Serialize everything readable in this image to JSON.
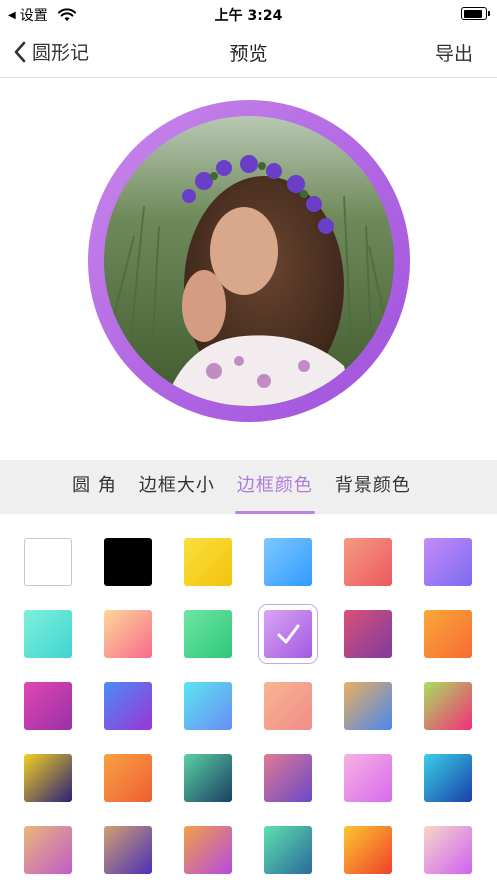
{
  "status_bar": {
    "back_app": "设置",
    "time": "上午 3:24",
    "battery_level": 0.9
  },
  "nav": {
    "back_label": "圆形记",
    "title": "预览",
    "action_label": "导出"
  },
  "preview": {
    "ring_color": "#b066e3"
  },
  "tabs": [
    {
      "label": "圆 角",
      "active": false
    },
    {
      "label": "边框大小",
      "active": false
    },
    {
      "label": "边框颜色",
      "active": true
    },
    {
      "label": "背景颜色",
      "active": false
    }
  ],
  "accent_color": "#b07ad8",
  "swatches": [
    {
      "name": "white",
      "from": "#ffffff",
      "to": "#ffffff",
      "selected": false
    },
    {
      "name": "black",
      "from": "#000000",
      "to": "#000000",
      "selected": false
    },
    {
      "name": "yellow",
      "from": "#f9e040",
      "to": "#f5c20a",
      "selected": false
    },
    {
      "name": "light-blue",
      "from": "#7ec8ff",
      "to": "#2f9bff",
      "selected": false
    },
    {
      "name": "salmon",
      "from": "#f69a82",
      "to": "#ea5a5f",
      "selected": false
    },
    {
      "name": "lavender-blue",
      "from": "#c48cf5",
      "to": "#7b6cf2",
      "selected": false
    },
    {
      "name": "aqua",
      "from": "#7ff0dc",
      "to": "#3fd4d0",
      "selected": false
    },
    {
      "name": "peach-pink",
      "from": "#fdd89a",
      "to": "#f76a8a",
      "selected": false
    },
    {
      "name": "green",
      "from": "#6de6a2",
      "to": "#2fc77a",
      "selected": false
    },
    {
      "name": "purple",
      "from": "#d9a4f4",
      "to": "#a259e0",
      "selected": true
    },
    {
      "name": "plum",
      "from": "#d9517a",
      "to": "#7f3a9c",
      "selected": false
    },
    {
      "name": "orange",
      "from": "#fba737",
      "to": "#f76b35",
      "selected": false
    },
    {
      "name": "magenta",
      "from": "#e048b0",
      "to": "#9a2fa8",
      "selected": false
    },
    {
      "name": "blue-violet",
      "from": "#4b8cf5",
      "to": "#9b35d6",
      "selected": false
    },
    {
      "name": "cyan-blue",
      "from": "#5be6f0",
      "to": "#6a8cf5",
      "selected": false
    },
    {
      "name": "apricot",
      "from": "#f8b690",
      "to": "#f08c8a",
      "selected": false
    },
    {
      "name": "sand-blue",
      "from": "#e8b060",
      "to": "#4a86f0",
      "selected": false
    },
    {
      "name": "lime-red",
      "from": "#a8e060",
      "to": "#f22e78",
      "selected": false
    },
    {
      "name": "gold-navy",
      "from": "#f2d020",
      "to": "#2a1f7a",
      "selected": false
    },
    {
      "name": "tangerine",
      "from": "#f8a040",
      "to": "#ee5f35",
      "selected": false
    },
    {
      "name": "teal-dark",
      "from": "#5ad0a6",
      "to": "#1a3f60",
      "selected": false
    },
    {
      "name": "rose-violet",
      "from": "#e07a92",
      "to": "#6a48c8",
      "selected": false
    },
    {
      "name": "pink-orchid",
      "from": "#f6b2e0",
      "to": "#d96af0",
      "selected": false
    },
    {
      "name": "sky-navy",
      "from": "#3ad0e8",
      "to": "#1a3fa8",
      "selected": false
    },
    {
      "name": "tan-orchid",
      "from": "#e8b878",
      "to": "#c25ac8",
      "selected": false
    },
    {
      "name": "bronze-indigo",
      "from": "#d0a070",
      "to": "#4a30b8",
      "selected": false
    },
    {
      "name": "amber-violet",
      "from": "#f2a048",
      "to": "#b44ae0",
      "selected": false
    },
    {
      "name": "mint-teal",
      "from": "#5ee0b0",
      "to": "#2a6a9a",
      "selected": false
    },
    {
      "name": "sun-orange",
      "from": "#fbc630",
      "to": "#f0402a",
      "selected": false
    },
    {
      "name": "cream-orchid",
      "from": "#f6d8c8",
      "to": "#d060f0",
      "selected": false
    }
  ]
}
